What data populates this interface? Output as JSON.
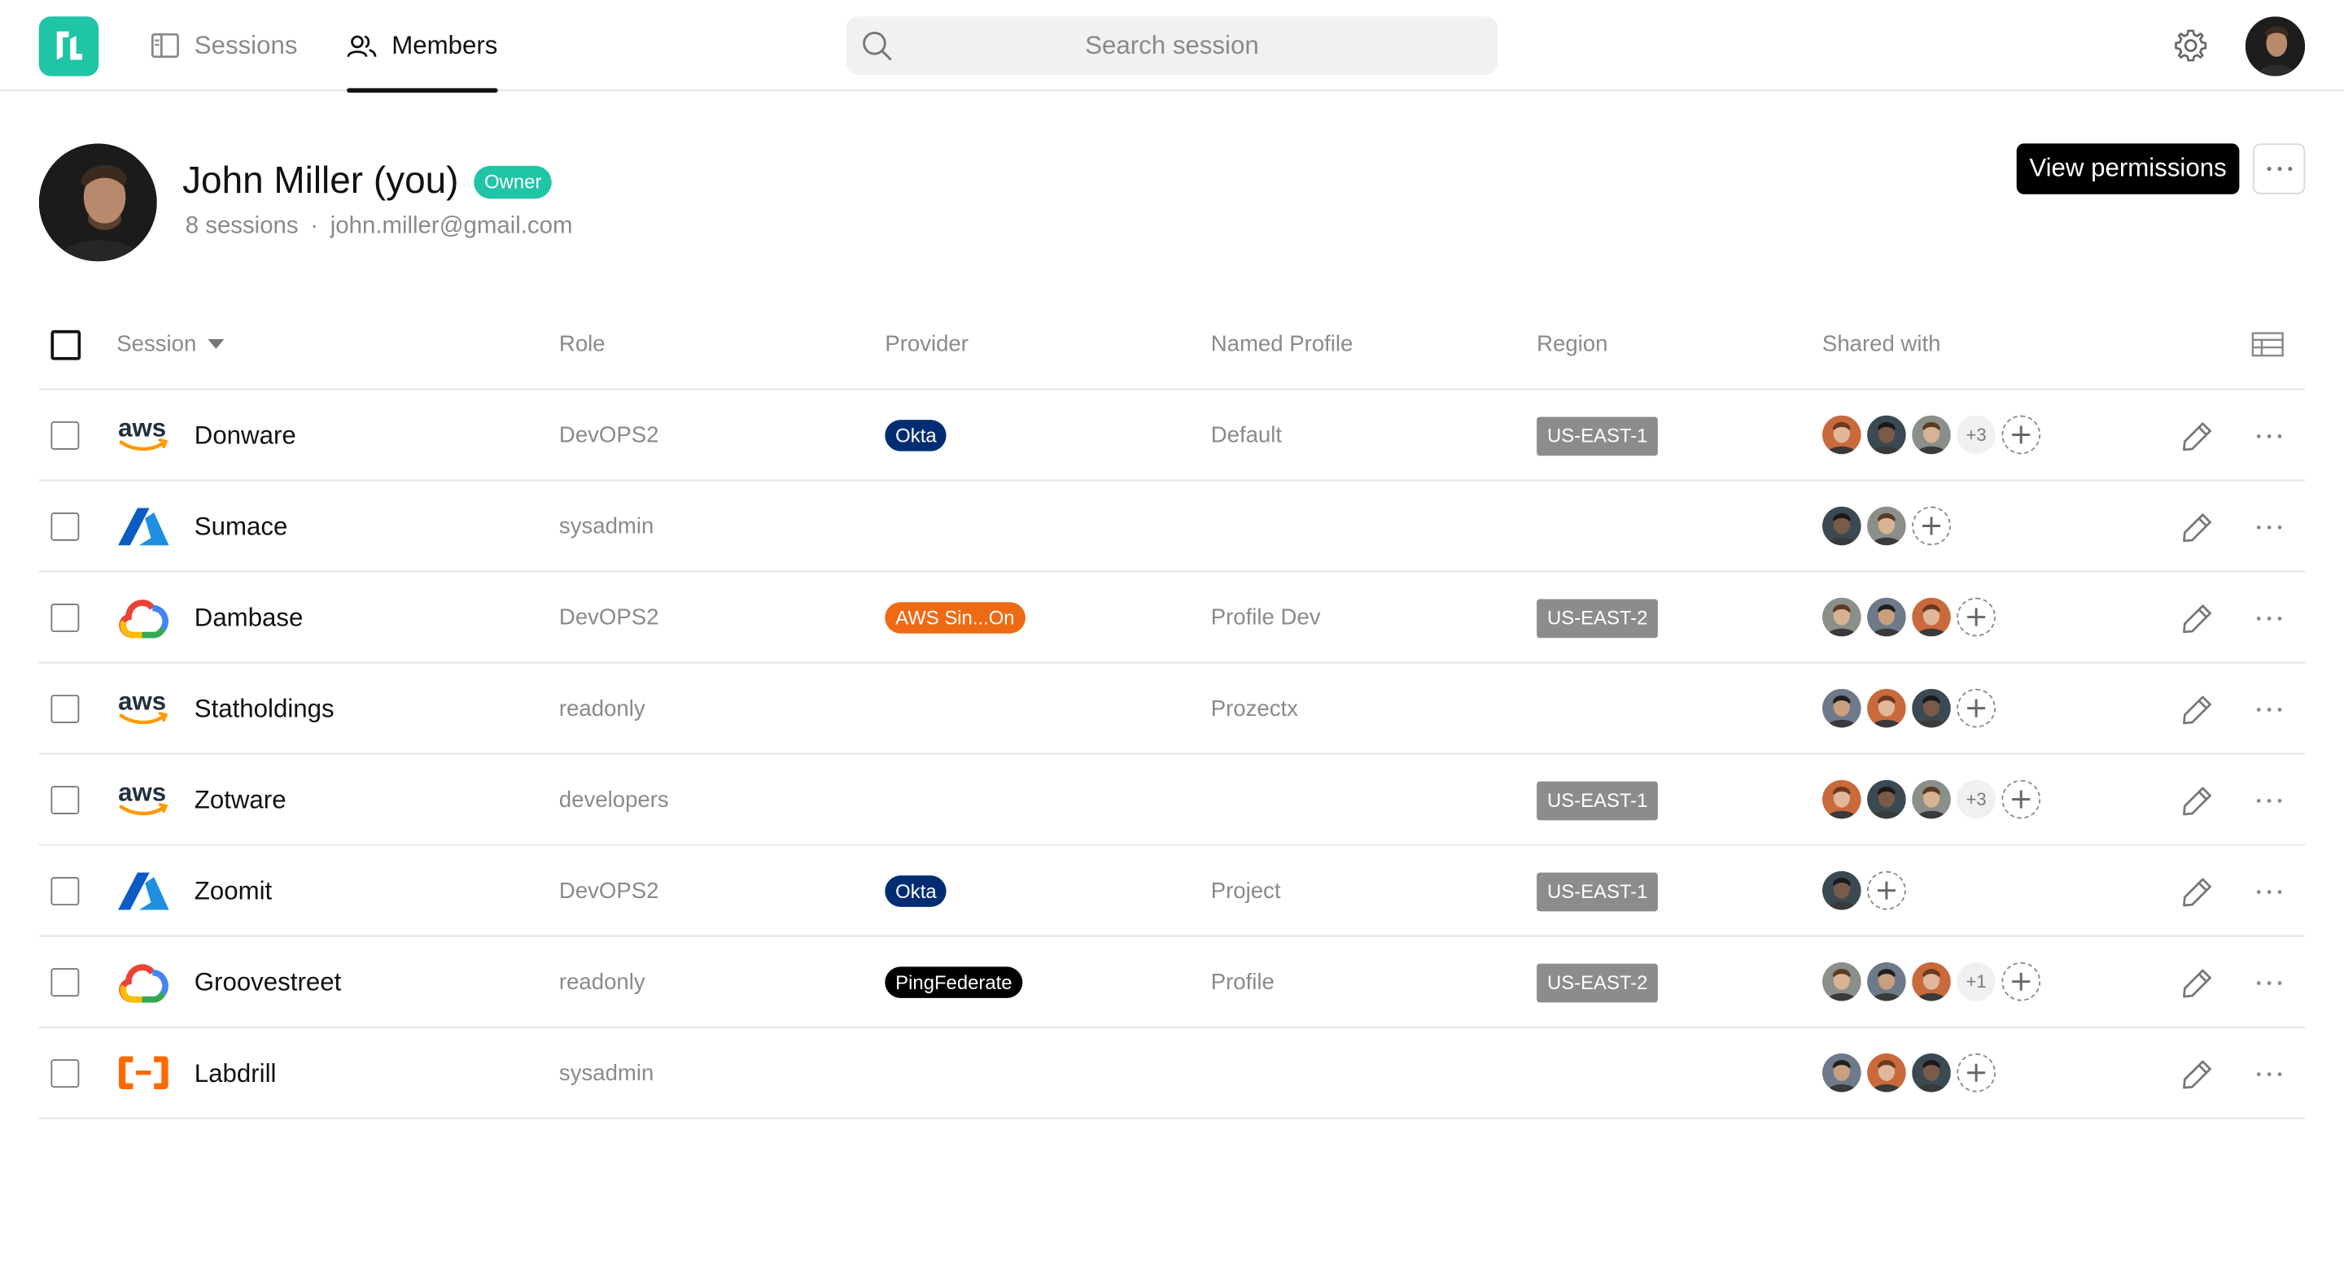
{
  "nav": {
    "sessions_label": "Sessions",
    "members_label": "Members",
    "active_tab": "Members"
  },
  "search": {
    "placeholder": "Search session",
    "value": ""
  },
  "colors": {
    "brand": "#20c4a6",
    "okta": "#002d72",
    "aws_sso": "#ee6a14",
    "ping": "#000000",
    "region": "#8c8c8c"
  },
  "profile": {
    "name": "John Miller (you)",
    "role_badge": "Owner",
    "sessions_count": "8 sessions",
    "separator": "·",
    "email": "john.miller@gmail.com",
    "primary_action": "View permissions"
  },
  "table": {
    "columns": {
      "session": "Session",
      "role": "Role",
      "provider": "Provider",
      "named_profile": "Named Profile",
      "region": "Region",
      "shared_with": "Shared with"
    },
    "rows": [
      {
        "logo": "aws-logo",
        "name": "Donware",
        "role": "DevOPS2",
        "provider": "Okta",
        "provider_type": "okta",
        "named_profile": "Default",
        "region": "US-EAST-1",
        "shared_avatars": 3,
        "shared_extra": "+3"
      },
      {
        "logo": "azure-logo",
        "name": "Sumace",
        "role": "sysadmin",
        "provider": "",
        "provider_type": "",
        "named_profile": "",
        "region": "",
        "shared_avatars": 2,
        "shared_extra": ""
      },
      {
        "logo": "gcp-logo",
        "name": "Dambase",
        "role": "DevOPS2",
        "provider": "AWS Sin...On",
        "provider_type": "aws-sso",
        "named_profile": "Profile Dev",
        "region": "US-EAST-2",
        "shared_avatars": 3,
        "shared_extra": ""
      },
      {
        "logo": "aws-logo",
        "name": "Statholdings",
        "role": "readonly",
        "provider": "",
        "provider_type": "",
        "named_profile": "Prozectx",
        "region": "",
        "shared_avatars": 3,
        "shared_extra": ""
      },
      {
        "logo": "aws-logo",
        "name": "Zotware",
        "role": "developers",
        "provider": "",
        "provider_type": "",
        "named_profile": "",
        "region": "US-EAST-1",
        "shared_avatars": 3,
        "shared_extra": "+3"
      },
      {
        "logo": "azure-logo",
        "name": "Zoomit",
        "role": "DevOPS2",
        "provider": "Okta",
        "provider_type": "okta",
        "named_profile": "Project",
        "region": "US-EAST-1",
        "shared_avatars": 1,
        "shared_extra": ""
      },
      {
        "logo": "gcp-logo",
        "name": "Groovestreet",
        "role": "readonly",
        "provider": "PingFederate",
        "provider_type": "ping",
        "named_profile": "Profile",
        "region": "US-EAST-2",
        "shared_avatars": 3,
        "shared_extra": "+1"
      },
      {
        "logo": "alibaba-logo",
        "name": "Labdrill",
        "role": "sysadmin",
        "provider": "",
        "provider_type": "",
        "named_profile": "",
        "region": "",
        "shared_avatars": 3,
        "shared_extra": ""
      }
    ]
  }
}
